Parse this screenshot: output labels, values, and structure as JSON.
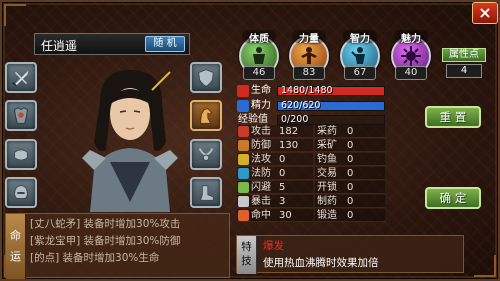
{
  "header": {
    "close_label": "×"
  },
  "character": {
    "name": "任逍遥",
    "random_label": "随 机"
  },
  "equipment": {
    "left": [
      "weapon",
      "armor",
      "bracer",
      "helmet"
    ],
    "right": [
      "shield",
      "pet",
      "necklace",
      "boots"
    ]
  },
  "fate": {
    "label_top": "命",
    "label_bottom": "运",
    "lines": [
      "[丈八蛇矛] 装备时增加30%攻击",
      "[紫龙宝甲] 装备时增加30%防御",
      "[的点] 装备时增加30%生命"
    ]
  },
  "stats": [
    {
      "label": "体质",
      "value": "46",
      "color": "#4a8a3a",
      "icon": "body-icon"
    },
    {
      "label": "力量",
      "value": "83",
      "color": "#b86a1a",
      "icon": "strength-icon"
    },
    {
      "label": "智力",
      "value": "67",
      "color": "#2a7a9a",
      "icon": "intellect-icon"
    },
    {
      "label": "魅力",
      "value": "40",
      "color": "#9a2ab8",
      "icon": "charm-icon"
    }
  ],
  "points": {
    "label": "属性点",
    "value": "4"
  },
  "bars": {
    "hp": {
      "label": "生命",
      "text": "1480/1480",
      "fill": 1.0,
      "color": "#d22a1e"
    },
    "mp": {
      "label": "精力",
      "text": "620/620",
      "fill": 1.0,
      "color": "#2a6ad2"
    },
    "exp": {
      "label": "经验值",
      "text": "0/200",
      "fill": 0.0,
      "color": "#d2a21e"
    }
  },
  "attributes": {
    "left": [
      {
        "name": "攻击",
        "value": "182",
        "color": "#c83a2a"
      },
      {
        "name": "防御",
        "value": "130",
        "color": "#c87a2a"
      },
      {
        "name": "法攻",
        "value": "0",
        "color": "#d2b02a"
      },
      {
        "name": "法防",
        "value": "0",
        "color": "#2a9ac8"
      },
      {
        "name": "闪避",
        "value": "5",
        "color": "#7ab84a"
      },
      {
        "name": "暴击",
        "value": "3",
        "color": "#c8c8c8"
      },
      {
        "name": "命中",
        "value": "30",
        "color": "#e0602a"
      }
    ],
    "right": [
      {
        "name": "采药",
        "value": "0"
      },
      {
        "name": "采矿",
        "value": "0"
      },
      {
        "name": "钓鱼",
        "value": "0"
      },
      {
        "name": "交易",
        "value": "0"
      },
      {
        "name": "开锁",
        "value": "0"
      },
      {
        "name": "制药",
        "value": "0"
      },
      {
        "name": "锻造",
        "value": "0"
      }
    ]
  },
  "buttons": {
    "reset": "重 置",
    "confirm": "确 定"
  },
  "skill": {
    "label_top": "特",
    "label_bottom": "技",
    "name": "爆发",
    "description": "使用热血沸腾时效果加倍"
  }
}
